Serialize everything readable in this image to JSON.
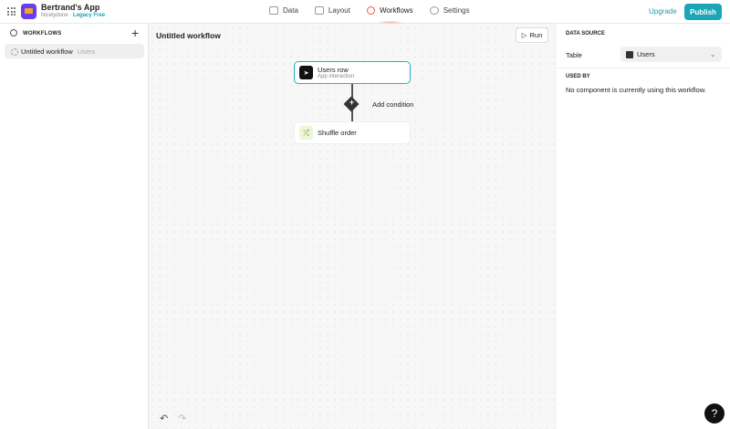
{
  "app": {
    "name": "Bertrand's App",
    "org": "Nicelydone",
    "plan": "Legacy Free"
  },
  "nav": [
    {
      "label": "Data"
    },
    {
      "label": "Layout"
    },
    {
      "label": "Workflows"
    },
    {
      "label": "Settings"
    }
  ],
  "header": {
    "upgrade": "Upgrade",
    "publish": "Publish"
  },
  "sidebar": {
    "title": "WORKFLOWS",
    "items": [
      {
        "name": "Untitled workflow",
        "source": "Users"
      }
    ]
  },
  "canvas": {
    "title": "Untitled workflow",
    "run": "Run",
    "trigger": {
      "title": "Users row",
      "subtitle": "App interaction"
    },
    "add_condition": "Add condition",
    "action": {
      "title": "Shuffle order"
    }
  },
  "panel": {
    "data_source": "DATA SOURCE",
    "table_label": "Table",
    "table_value": "Users",
    "used_by": "USED BY",
    "used_by_text": "No component is currently using this workflow."
  },
  "help": "?"
}
